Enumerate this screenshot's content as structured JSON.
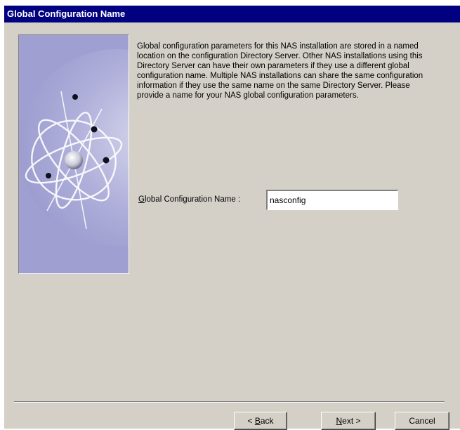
{
  "window": {
    "title": "Global Configuration Name"
  },
  "description": "Global configuration parameters for this NAS installation are stored in a named location on the configuration Directory Server. Other NAS installations using this Directory Server can have their own parameters if they use a different global configuration name. Multiple NAS installations can share the same configuration information if they use the same name on the same Directory Server. Please provide a name for your NAS global configuration parameters.",
  "field": {
    "label_mnemonic": "G",
    "label_rest": "lobal Configuration Name :",
    "value": "nasconfig"
  },
  "buttons": {
    "back_prefix": "< ",
    "back_mnemonic": "B",
    "back_rest": "ack",
    "next_mnemonic": "N",
    "next_rest": "ext >",
    "cancel": "Cancel"
  },
  "colors": {
    "title_bar": "#000080",
    "dialog_bg": "#d4d0c8",
    "image_bg": "#9f9fd2"
  },
  "icons": {
    "wizard_image": "atom-orbit-graphic"
  }
}
